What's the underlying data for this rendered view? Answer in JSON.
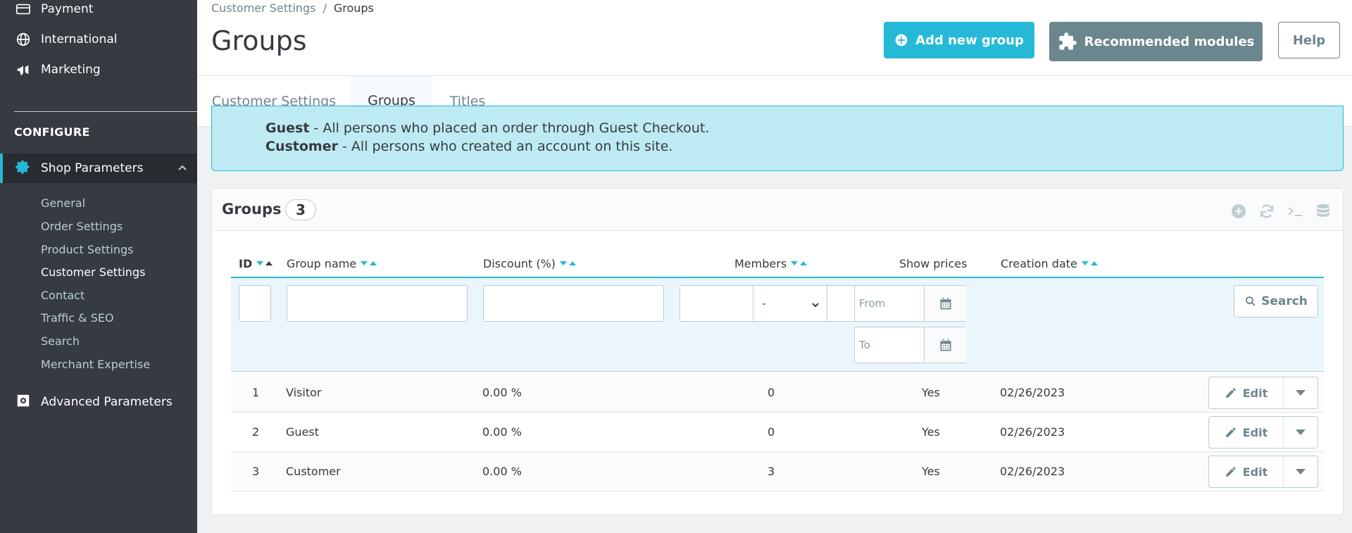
{
  "sidebar": {
    "items_top": [
      {
        "label": "Payment",
        "icon": "credit-card-icon"
      },
      {
        "label": "International",
        "icon": "globe-icon"
      },
      {
        "label": "Marketing",
        "icon": "megaphone-icon"
      }
    ],
    "section_title": "CONFIGURE",
    "shop_parameters": "Shop Parameters",
    "sub_items": [
      "General",
      "Order Settings",
      "Product Settings",
      "Customer Settings",
      "Contact",
      "Traffic & SEO",
      "Search",
      "Merchant Expertise"
    ],
    "active_sub": "Customer Settings",
    "advanced": "Advanced Parameters"
  },
  "header": {
    "breadcrumb_parent": "Customer Settings",
    "breadcrumb_sep": "/",
    "breadcrumb_current": "Groups",
    "title": "Groups",
    "add_button": "Add new group",
    "modules_button": "Recommended modules",
    "help_button": "Help",
    "tabs": [
      "Customer Settings",
      "Groups",
      "Titles"
    ],
    "active_tab": "Groups"
  },
  "alert": {
    "guest_name": "Guest",
    "guest_text": " - All persons who placed an order through Guest Checkout.",
    "customer_name": "Customer",
    "customer_text": " - All persons who created an account on this site."
  },
  "panel": {
    "title": "Groups",
    "count": "3",
    "tools": [
      "add-icon",
      "refresh-icon",
      "sql-query-icon",
      "export-database-icon"
    ]
  },
  "table": {
    "headers": {
      "id": "ID",
      "group_name": "Group name",
      "discount": "Discount (%)",
      "members": "Members",
      "show_prices": "Show prices",
      "creation_date": "Creation date"
    },
    "filters": {
      "show_prices_value": "-",
      "from_placeholder": "From",
      "to_placeholder": "To",
      "search_button": "Search"
    },
    "rows": [
      {
        "id": "1",
        "name": "Visitor",
        "discount": "0.00 %",
        "members": "0",
        "show_prices": "Yes",
        "date": "02/26/2023",
        "action": "Edit"
      },
      {
        "id": "2",
        "name": "Guest",
        "discount": "0.00 %",
        "members": "0",
        "show_prices": "Yes",
        "date": "02/26/2023",
        "action": "Edit"
      },
      {
        "id": "3",
        "name": "Customer",
        "discount": "0.00 %",
        "members": "3",
        "show_prices": "Yes",
        "date": "02/26/2023",
        "action": "Edit"
      }
    ]
  },
  "colors": {
    "accent": "#25b9d7",
    "sidebar_bg": "#363a41",
    "alert_bg": "#beeaf3",
    "secondary": "#6c868e"
  }
}
